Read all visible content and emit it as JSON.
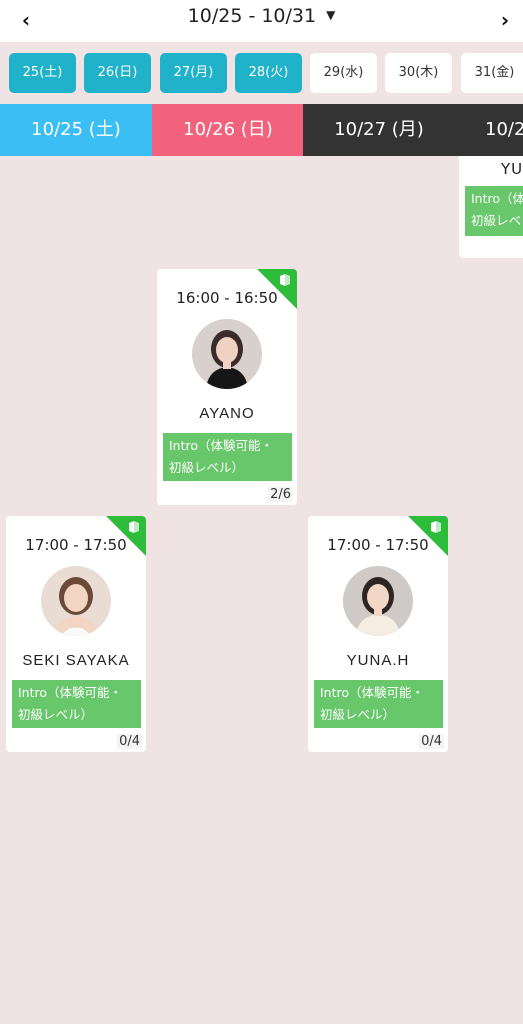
{
  "header": {
    "prev": "‹",
    "next": "›",
    "range": "10/25 - 10/31",
    "caret": "▼"
  },
  "chips": [
    "25(土)",
    "26(日)",
    "27(月)",
    "28(火)",
    "29(水)",
    "30(木)",
    "31(金)"
  ],
  "days": [
    "10/25 (土)",
    "10/26 (日)",
    "10/27 (月)",
    "10/2"
  ],
  "partial": {
    "name": "YU",
    "level": "Intro（体験可能・初級レベル）",
    "level_line1": "Intro（体",
    "level_line2": "初級レベ"
  },
  "lessons": [
    {
      "time": "16:00 - 16:50",
      "name": "AYANO",
      "level_line1": "Intro（体験可能・",
      "level_line2": "初級レベル）",
      "count": "2/6",
      "badge": "beginner-icon"
    },
    {
      "time": "17:00 - 17:50",
      "name": "SEKI SAYAKA",
      "level_line1": "Intro（体験可能・",
      "level_line2": "初級レベル）",
      "count": "0/4",
      "badge": "beginner-icon"
    },
    {
      "time": "17:00 - 17:50",
      "name": "YUNA.H",
      "level_line1": "Intro（体験可能・",
      "level_line2": "初級レベル）",
      "count": "0/4",
      "badge": "beginner-icon"
    }
  ],
  "colors": {
    "active_chip": "#1fb2c9",
    "saturday": "#3bbef4",
    "sunday": "#f3627c",
    "weekday": "#333333",
    "level": "#67c76a",
    "badge": "#2ebd3a",
    "background": "#efe3e3"
  }
}
